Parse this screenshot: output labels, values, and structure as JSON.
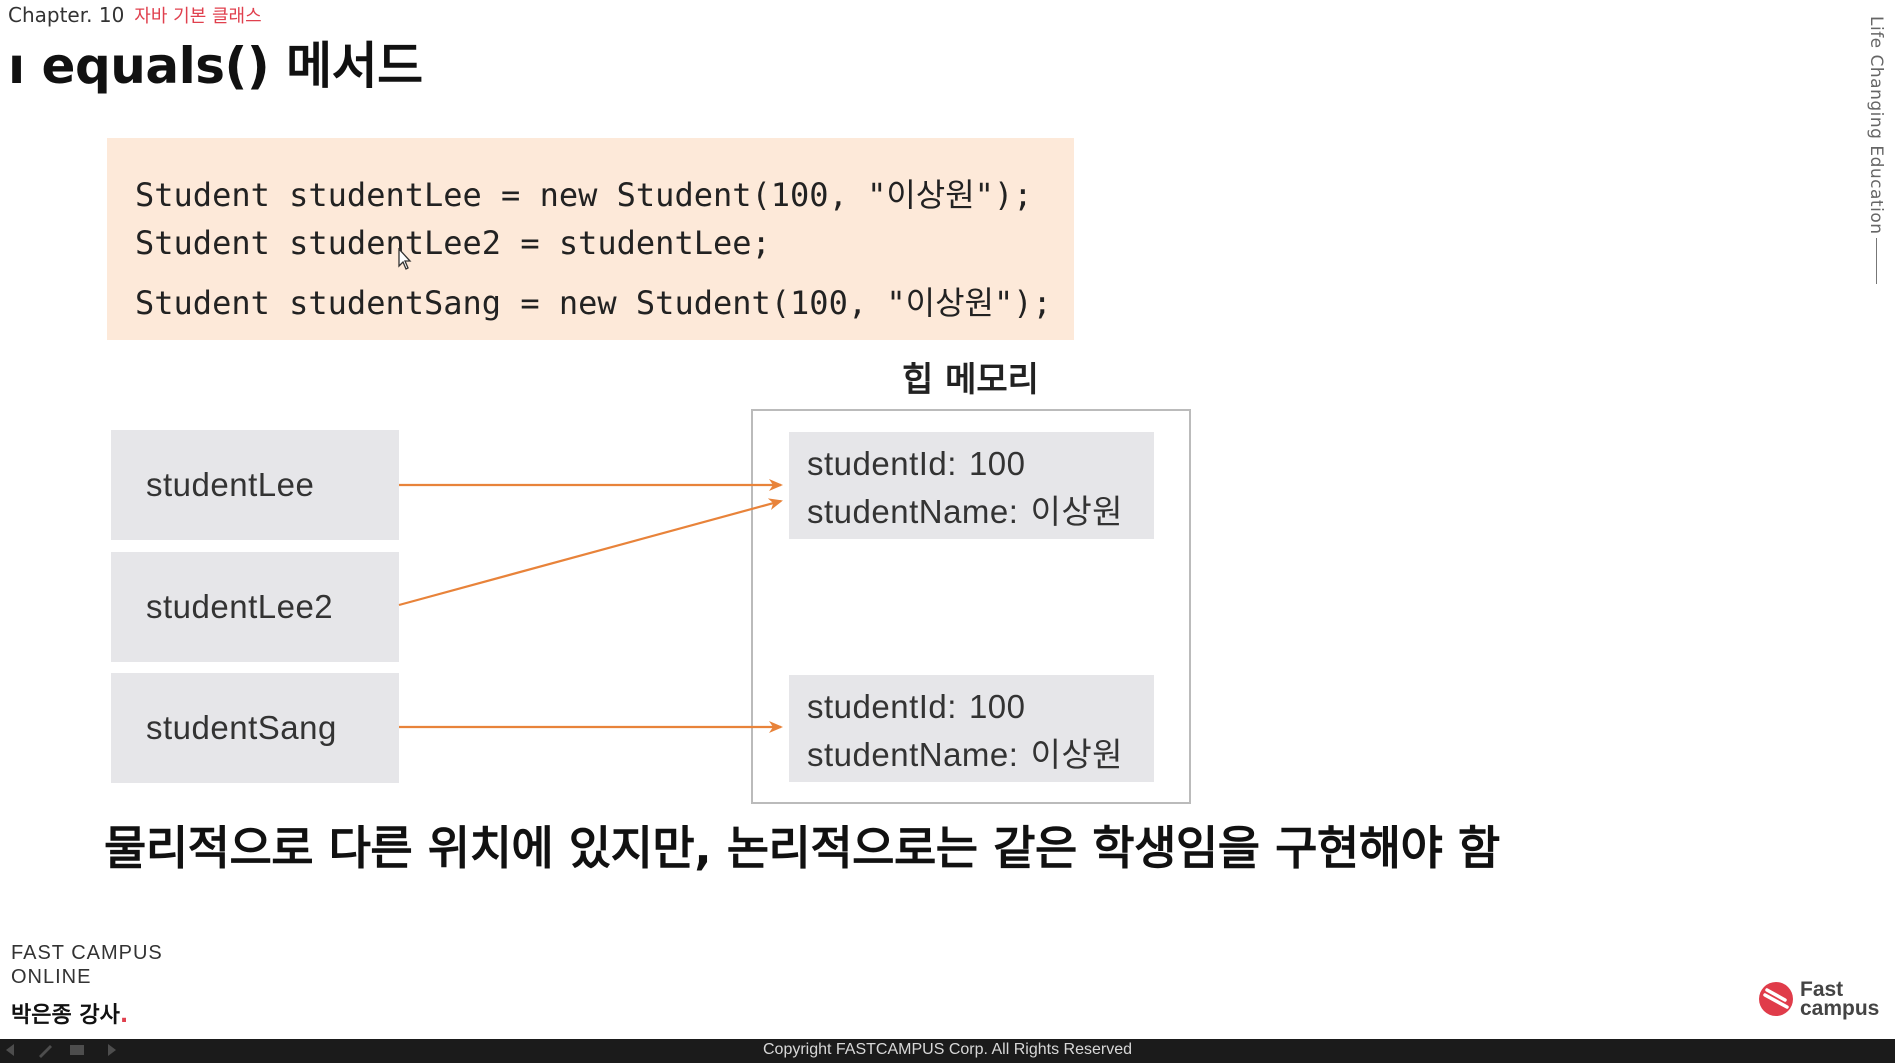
{
  "header": {
    "chapter_label": "Chapter. 10",
    "chapter_subtitle": "자바 기본 클래스",
    "title": "ı equals() 메서드"
  },
  "tagline": "Life Changing Education",
  "code": {
    "lines": [
      "Student studentLee = new Student(100, \"이상원\");",
      "Student studentLee2 = studentLee;",
      "Student studentSang = new Student(100, \"이상원\");"
    ]
  },
  "diagram": {
    "heap_label": "힙 메모리",
    "variables": [
      "studentLee",
      "studentLee2",
      "studentSang"
    ],
    "objects": [
      {
        "id_label": "studentId:",
        "id_value": "100",
        "name_label": "studentName:",
        "name_value": "이상원"
      },
      {
        "id_label": "studentId:",
        "id_value": "100",
        "name_label": "studentName:",
        "name_value": "이상원"
      }
    ],
    "arrow_color": "#e8833a"
  },
  "caption": "물리적으로 다른 위치에 있지만, 논리적으로는 같은 학생임을 구현해야 함",
  "branding": {
    "line1": "FAST CAMPUS",
    "line2": "ONLINE",
    "instructor": "박은종 강사",
    "instructor_dot": "."
  },
  "logo": {
    "line1": "Fast",
    "line2": "campus",
    "color": "#e03c4a"
  },
  "footer": {
    "copyright": "Copyright FASTCAMPUS Corp. All Rights Reserved"
  },
  "icons": {
    "cursor": "mouse-cursor-icon",
    "logo": "fastcampus-logo-icon"
  }
}
